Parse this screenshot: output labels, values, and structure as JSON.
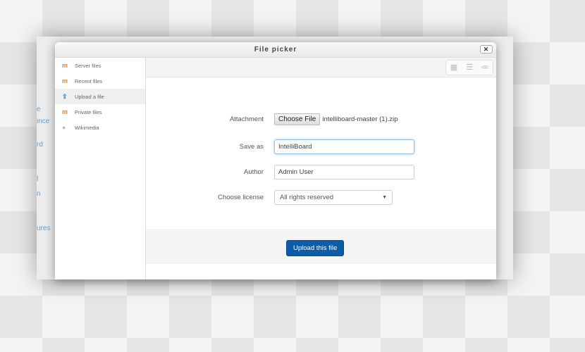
{
  "background_page": {
    "fragments": [
      "e",
      "ince",
      "rd",
      "l",
      "n",
      "ures"
    ]
  },
  "dialog": {
    "title": "File picker",
    "close_label": "✕",
    "sidebar": [
      {
        "label": "Server files",
        "icon": "moodle-icon"
      },
      {
        "label": "Recent files",
        "icon": "moodle-icon"
      },
      {
        "label": "Upload a file",
        "icon": "upload-icon",
        "active": true
      },
      {
        "label": "Private files",
        "icon": "moodle-icon"
      },
      {
        "label": "Wikimedia",
        "icon": "wikimedia-icon"
      }
    ],
    "view_buttons": [
      "icons-view",
      "list-view",
      "tree-view"
    ],
    "form": {
      "attachment_label": "Attachment",
      "choose_file": "Choose File",
      "file_name": "intelliboard-master (1).zip",
      "save_as_label": "Save as",
      "save_as_value": "IntelliBoard",
      "author_label": "Author",
      "author_value": "Admin User",
      "license_label": "Choose license",
      "license_value": "All rights reserved"
    },
    "upload_button": "Upload this file"
  },
  "colors": {
    "accent": "#0d5ca8"
  }
}
